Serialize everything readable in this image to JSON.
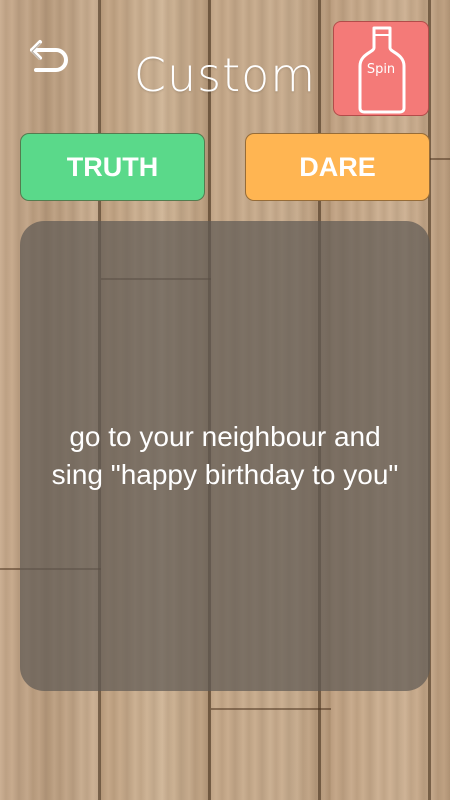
{
  "header": {
    "title": "Custom",
    "back_icon": "back-arrow-icon",
    "spin_label": "Spin",
    "spin_icon": "bottle-icon",
    "spin_color": "#f47a78"
  },
  "tabs": {
    "truth_label": "TRUTH",
    "dare_label": "DARE",
    "truth_color": "#5ad98a",
    "dare_color": "#ffb552"
  },
  "card": {
    "text": "go to your neighbour and sing \"happy birthday to you\""
  }
}
